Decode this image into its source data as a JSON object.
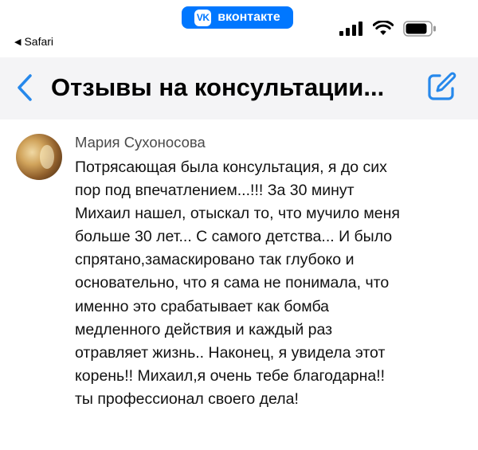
{
  "status_bar": {
    "back_app_label": "Safari",
    "app_badge_logo": "VK",
    "app_badge_label": "вконтакте",
    "icons": [
      "cellular-signal-icon",
      "wifi-icon",
      "battery-icon"
    ]
  },
  "header": {
    "title": "Отзывы на консультации...",
    "back_icon": "chevron-left-icon",
    "edit_icon": "edit-icon"
  },
  "comment": {
    "author": "Мария Сухоносова",
    "text_lines": [
      "Потрясающая была консультация, я до сих",
      "пор под впечатлением...!!! За 30 минут",
      "Михаил нашел, отыскал то, что мучило меня",
      "больше 30 лет... С самого детства... И было",
      "спрятано,замаскировано так глубоко и",
      "основательно, что я сама не понимала, что",
      "именно это срабатывает как бомба",
      "медленного действия и каждый раз",
      "отравляет жизнь.. Наконец, я увидела этот",
      "корень!! Михаил,я очень тебе благодарна!!",
      "ты профессионал своего дела!"
    ]
  },
  "colors": {
    "accent": "#0077ff",
    "header_bg": "#f4f4f6",
    "author": "#4a4a4a"
  }
}
